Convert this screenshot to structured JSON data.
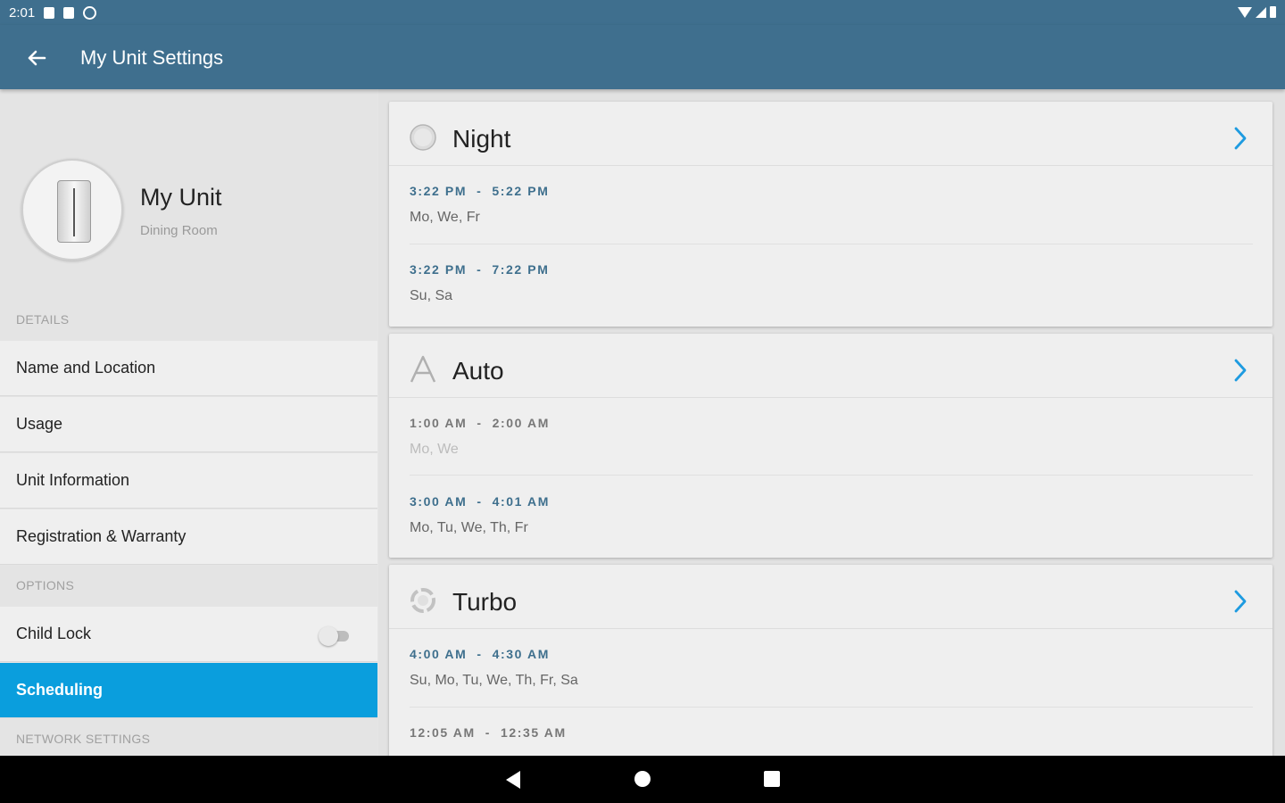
{
  "status_bar": {
    "time": "2:01"
  },
  "app_bar": {
    "title": "My Unit Settings"
  },
  "unit": {
    "name": "My Unit",
    "location": "Dining Room"
  },
  "sidebar": {
    "sections": {
      "details": "DETAILS",
      "options": "OPTIONS",
      "network": "NETWORK SETTINGS"
    },
    "items": [
      {
        "label": "Name and Location"
      },
      {
        "label": "Usage"
      },
      {
        "label": "Unit Information"
      },
      {
        "label": "Registration & Warranty"
      },
      {
        "label": "Child Lock",
        "toggle": "off"
      },
      {
        "label": "Scheduling",
        "active": true
      }
    ]
  },
  "schedules": [
    {
      "mode": "Night",
      "icon": "night-mode-icon",
      "entries": [
        {
          "start": "3:22 PM",
          "sep": "-",
          "end": "5:22 PM",
          "days": "Mo, We, Fr"
        },
        {
          "start": "3:22 PM",
          "sep": "-",
          "end": "7:22 PM",
          "days": "Su, Sa"
        }
      ]
    },
    {
      "mode": "Auto",
      "icon": "auto-mode-icon",
      "entries": [
        {
          "start": "1:00 AM",
          "sep": "-",
          "end": "2:00 AM",
          "days": "Mo, We",
          "disabled": true
        },
        {
          "start": "3:00 AM",
          "sep": "-",
          "end": "4:01 AM",
          "days": "Mo, Tu, We, Th, Fr"
        }
      ]
    },
    {
      "mode": "Turbo",
      "icon": "turbo-mode-icon",
      "entries": [
        {
          "start": "4:00 AM",
          "sep": "-",
          "end": "4:30 AM",
          "days": "Su, Mo, Tu, We, Th, Fr, Sa"
        },
        {
          "start": "12:05 AM",
          "sep": "-",
          "end": "12:35 AM",
          "days": "",
          "disabled": true
        }
      ]
    }
  ],
  "colors": {
    "app_bar": "#3f6f8e",
    "accent": "#0a9edd",
    "time_text": "#3e6f8d",
    "chevron": "#1e9be0"
  }
}
